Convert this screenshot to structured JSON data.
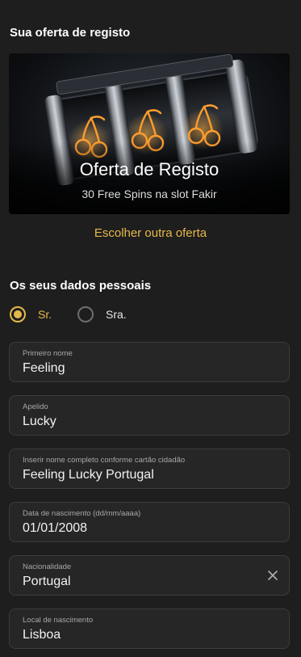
{
  "offer": {
    "section_title": "Sua oferta de registo",
    "banner": {
      "title": "Oferta de Registo",
      "subtitle": "30 Free Spins na slot Fakir",
      "image": "slot-machine-cherries-image"
    },
    "change_offer_link": "Escolher outra oferta"
  },
  "personal": {
    "section_title": "Os seus dados pessoais",
    "salutation": {
      "selected": "Sr.",
      "options": [
        "Sr.",
        "Sra."
      ]
    },
    "fields": [
      {
        "label": "Primeiro nome",
        "value": "Feeling"
      },
      {
        "label": "Apelido",
        "value": "Lucky"
      },
      {
        "label": "Inserir nome completo conforme cartão cidadão",
        "value": "Feeling Lucky Portugal"
      },
      {
        "label": "Data de nascimento (dd/mm/aaaa)",
        "value": "01/01/2008"
      },
      {
        "label": "Nacionalidade",
        "value": "Portugal",
        "clear_icon": "close-icon"
      },
      {
        "label": "Local de nascimento",
        "value": "Lisboa"
      }
    ]
  },
  "colors": {
    "background": "#1e1e1e",
    "accent": "#e6b84a",
    "field_background": "#262626",
    "field_border": "#3c3c3c",
    "label_text": "#a8a8a8",
    "value_text": "#f2f2f2"
  }
}
